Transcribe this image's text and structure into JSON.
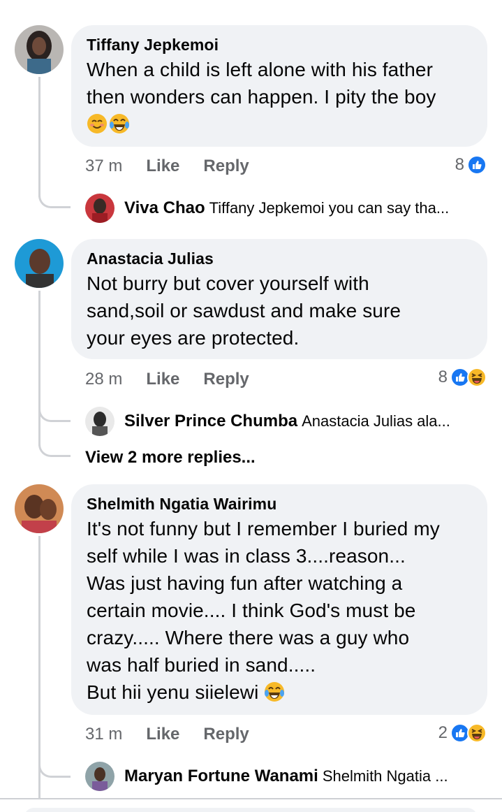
{
  "comments": [
    {
      "author": "Tiffany Jepkemoi",
      "lines": [
        "When a child is left alone with his father",
        "then wonders can happen. I pity the boy"
      ],
      "emojis": [
        "smiling-face-icon",
        "tears-of-joy-icon"
      ],
      "time": "37 m",
      "like_label": "Like",
      "reply_label": "Reply",
      "reaction_count": "8",
      "reactions": [
        "like-icon"
      ],
      "reply": {
        "author": "Viva Chao",
        "text": "Tiffany Jepkemoi you can say tha..."
      }
    },
    {
      "author": "Anastacia Julias",
      "lines": [
        "Not burry but cover yourself with",
        "sand,soil or sawdust and make sure",
        "your eyes are protected."
      ],
      "time": "28 m",
      "like_label": "Like",
      "reply_label": "Reply",
      "reaction_count": "8",
      "reactions": [
        "like-icon",
        "haha-icon"
      ],
      "reply": {
        "author": "Silver Prince Chumba",
        "text": "Anastacia Julias ala..."
      },
      "view_more": "View 2 more replies..."
    },
    {
      "author": "Shelmith Ngatia Wairimu",
      "lines": [
        "It's not funny but I remember I buried my",
        "self while I was in class 3....reason...",
        "Was just having fun after watching a",
        "certain movie.... I think God's must be",
        "crazy..... Where there was a guy who",
        "was half buried in sand.....",
        "But hii yenu siielewi"
      ],
      "time": "31 m",
      "like_label": "Like",
      "reply_label": "Reply",
      "reaction_count": "2",
      "reactions": [
        "like-icon",
        "haha-icon"
      ],
      "reply": {
        "author": "Maryan Fortune Wanami",
        "text": "Shelmith Ngatia ..."
      }
    }
  ],
  "colors": {
    "bubble": "#f0f2f5",
    "meta": "#65676b",
    "like_blue": "#1877f2",
    "haha_yellow": "#f7b928"
  }
}
